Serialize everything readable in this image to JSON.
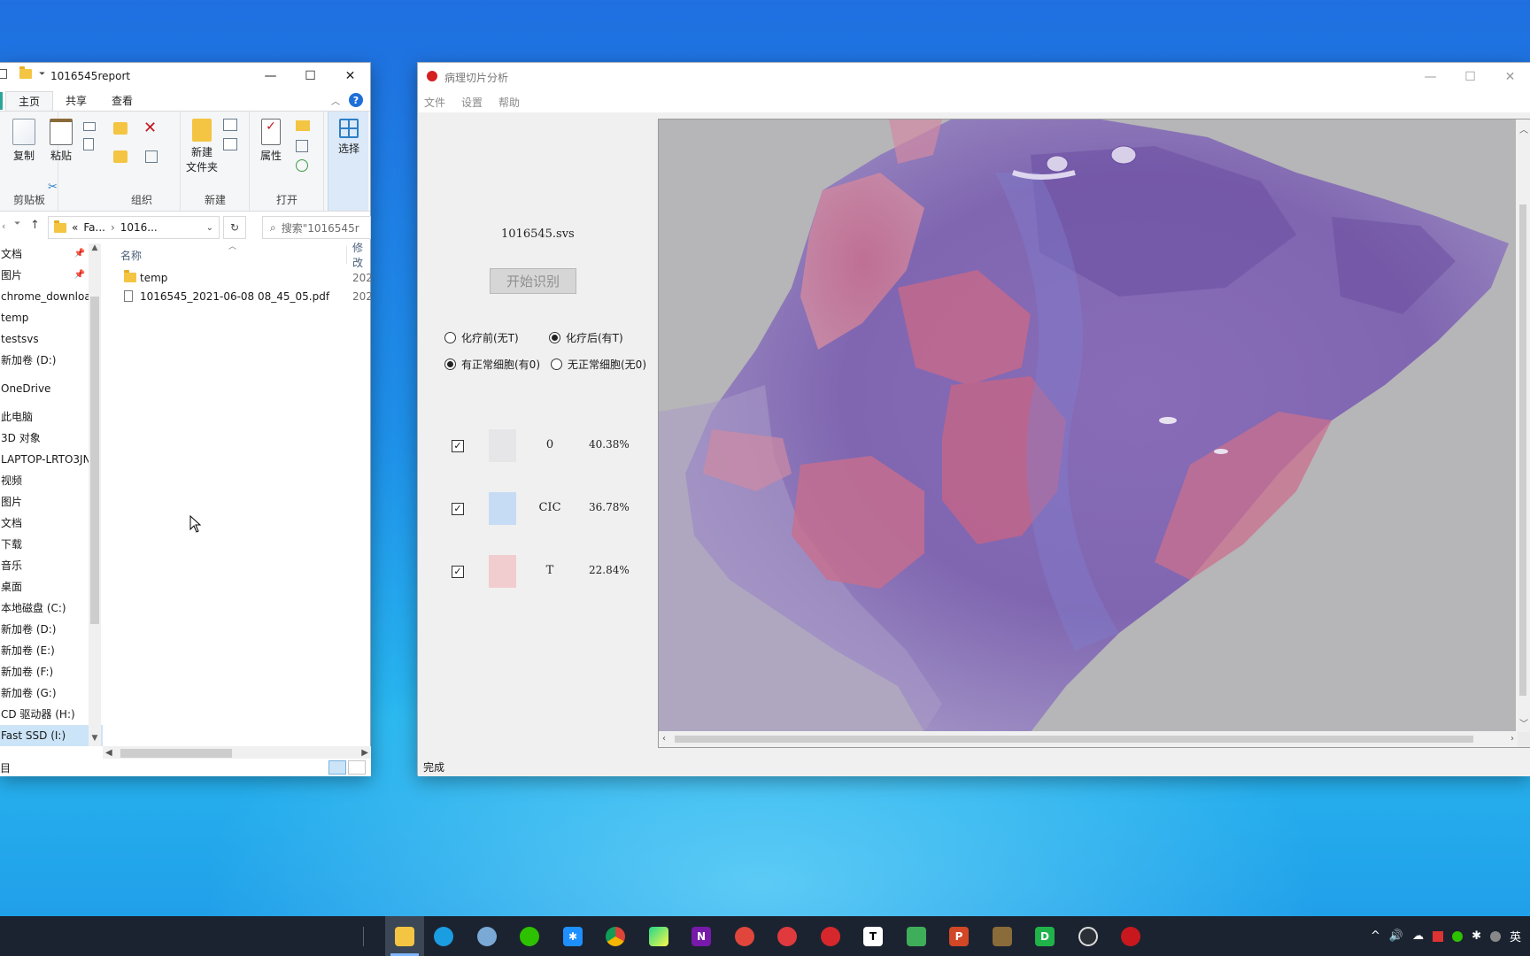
{
  "explorer": {
    "title": "1016545report",
    "tabs": [
      "主页",
      "共享",
      "查看"
    ],
    "groups": {
      "clipboard": {
        "label": "剪贴板",
        "copy": "复制",
        "paste": "粘贴"
      },
      "organize": {
        "label": "组织"
      },
      "new": {
        "label": "新建",
        "new_folder_1": "新建",
        "new_folder_2": "文件夹"
      },
      "open": {
        "label": "打开",
        "properties": "属性"
      },
      "select": {
        "label": "选择"
      }
    },
    "address": {
      "prefix": "«",
      "crumb1": "Fa...",
      "crumb2": "1016..."
    },
    "search_placeholder": "搜索\"1016545r",
    "nav_items": [
      {
        "label": "文档",
        "pinned": true
      },
      {
        "label": "图片",
        "pinned": true
      },
      {
        "label": "chrome_downloa"
      },
      {
        "label": "temp"
      },
      {
        "label": "testsvs"
      },
      {
        "label": "新加卷 (D:)"
      },
      {
        "label": "OneDrive"
      },
      {
        "label": "此电脑"
      },
      {
        "label": "3D 对象"
      },
      {
        "label": "LAPTOP-LRTO3JN"
      },
      {
        "label": "视频"
      },
      {
        "label": "图片"
      },
      {
        "label": "文档"
      },
      {
        "label": "下载"
      },
      {
        "label": "音乐"
      },
      {
        "label": "桌面"
      },
      {
        "label": "本地磁盘 (C:)"
      },
      {
        "label": "新加卷 (D:)"
      },
      {
        "label": "新加卷 (E:)"
      },
      {
        "label": "新加卷 (F:)"
      },
      {
        "label": "新加卷 (G:)"
      },
      {
        "label": "CD 驱动器 (H:)"
      },
      {
        "label": "Fast SSD (I:)"
      }
    ],
    "columns": {
      "name": "名称",
      "modified": "修改"
    },
    "files": [
      {
        "name": "temp",
        "date": "202",
        "type": "folder"
      },
      {
        "name": "1016545_2021-06-08 08_45_05.pdf",
        "date": "202",
        "type": "pdf"
      }
    ],
    "status_text": "目"
  },
  "pathology": {
    "title": "病理切片分析",
    "menu": [
      "文件",
      "设置",
      "帮助"
    ],
    "filename": "1016545.svs",
    "start_button": "开始识别",
    "radio_groups": [
      [
        {
          "label": "化疗前(无T)",
          "checked": false
        },
        {
          "label": "化疗后(有T)",
          "checked": true
        }
      ],
      [
        {
          "label": "有正常细胞(有0)",
          "checked": true
        },
        {
          "label": "无正常细胞(无0)",
          "checked": false
        }
      ]
    ],
    "legend": [
      {
        "checked": true,
        "label": "0",
        "percent": "40.38%",
        "color": "#e6e6e8"
      },
      {
        "checked": true,
        "label": "CIC",
        "percent": "36.78%",
        "color": "#c6dcf5"
      },
      {
        "checked": true,
        "label": "T",
        "percent": "22.84%",
        "color": "#f1cdd0"
      }
    ],
    "status": "完成"
  },
  "colors": {
    "tissue_purple": "#7a5fb0",
    "tissue_pink": "#d2708a",
    "slide_background": "#b6b5b8"
  },
  "taskbar": {
    "apps": [
      "file-explorer",
      "edge",
      "chrome-dev",
      "wechat",
      "app-blue",
      "chrome",
      "pycharm",
      "onenote",
      "app-red",
      "netease-1",
      "netease-2",
      "typora",
      "app-green",
      "powerpoint",
      "game",
      "app-d",
      "app-circle",
      "app-red-2"
    ],
    "tray_lang": "英"
  }
}
